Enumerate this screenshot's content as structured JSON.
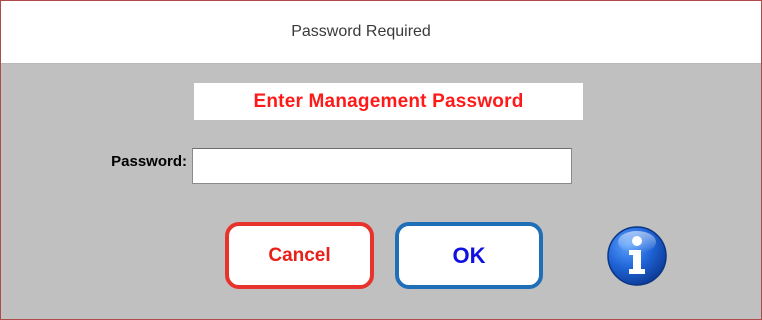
{
  "window": {
    "title": "Password Required"
  },
  "dialog": {
    "heading": "Enter Management Password",
    "password_label": "Password:",
    "password_value": "",
    "password_placeholder": "",
    "cancel_label": "Cancel",
    "ok_label": "OK",
    "info_icon": "info-icon"
  },
  "colors": {
    "dialog_background": "#c0c0c0",
    "heading_text": "#ff1a1a",
    "cancel_border": "#e8332c",
    "cancel_text": "#e8201a",
    "ok_border": "#1f6fb8",
    "ok_text": "#1010e0",
    "info_icon": "#1a5fc4"
  }
}
